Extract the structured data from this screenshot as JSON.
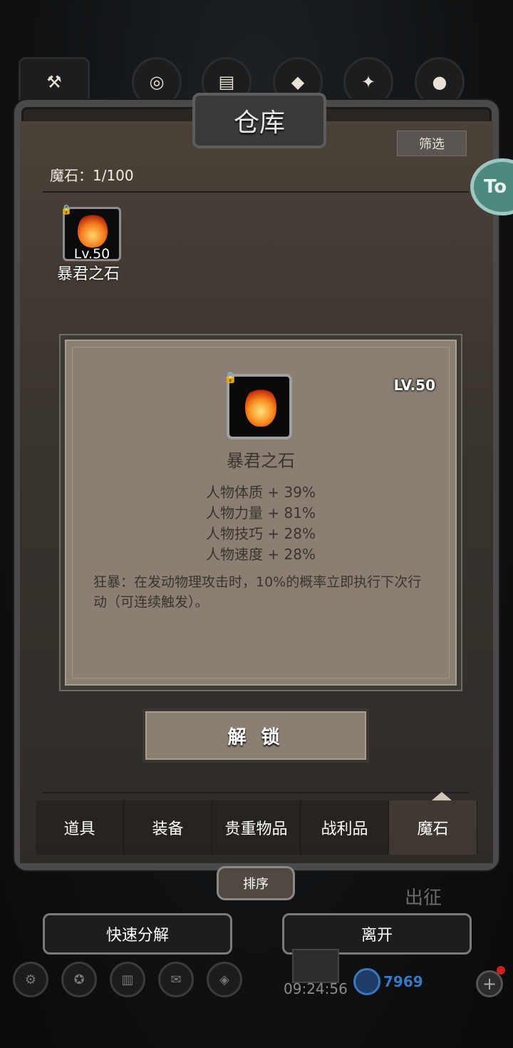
{
  "panel": {
    "title": "仓库",
    "filter_label": "筛选",
    "badge_text": "To",
    "count_label": "魔石：1/100"
  },
  "slot": {
    "level": "Lv.50",
    "name": "暴君之石"
  },
  "detail": {
    "level": "LV.50",
    "name": "暴君之石",
    "stats": [
      "人物体质 + 39%",
      "人物力量 + 81%",
      "人物技巧 + 28%",
      "人物速度 + 28%"
    ],
    "effect": "狂暴：在发动物理攻击时，10%的概率立即执行下次行动（可连续触发）。"
  },
  "unlock_label": "解 锁",
  "tabs": [
    "道具",
    "装备",
    "贵重物品",
    "战利品",
    "魔石"
  ],
  "active_tab": "魔石",
  "sort_label": "排序",
  "background_text": "出征",
  "buttons": {
    "quick_decompose": "快速分解",
    "leave": "离开"
  },
  "footer": {
    "time": "09:24:56",
    "gem_count": "7969"
  },
  "colors": {
    "card_bg": "#8a7f72",
    "panel_bg": "#2a2621",
    "gem_blue": "#3a78c4"
  },
  "icons": [
    "lock-icon",
    "flame-stone-icon",
    "gem-icon",
    "plus-icon",
    "chest-icon"
  ]
}
